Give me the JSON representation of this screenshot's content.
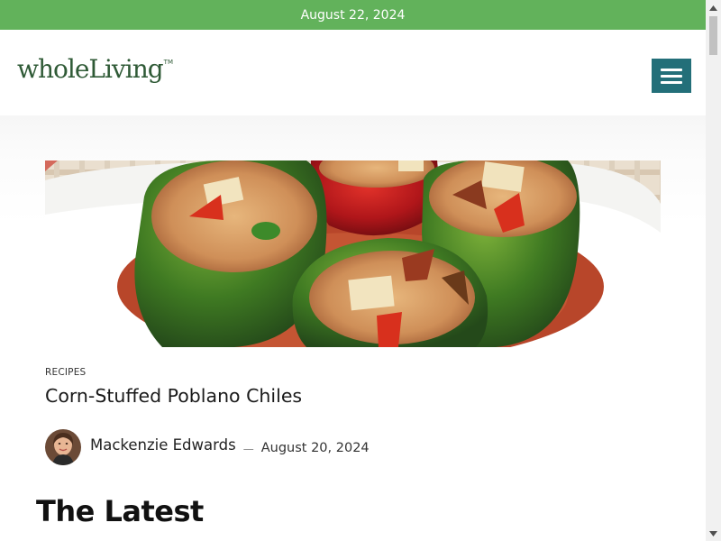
{
  "top_bar": {
    "date": "August 22, 2024",
    "background": "#62b25b"
  },
  "header": {
    "logo_text": "wholeLiving",
    "logo_mark": "TM",
    "menu_icon": "hamburger-menu-icon",
    "menu_color": "#236f79"
  },
  "featured": {
    "image": "stuffed-peppers-photo",
    "category": "RECIPES",
    "title": "Corn-Stuffed Poblano Chiles",
    "author": "Mackenzie Edwards",
    "separator": "—",
    "date": "August 20, 2024"
  },
  "latest": {
    "heading": "The Latest"
  },
  "scrollbar": {
    "up_icon": "scroll-up-arrow-icon",
    "down_icon": "scroll-down-arrow-icon"
  }
}
